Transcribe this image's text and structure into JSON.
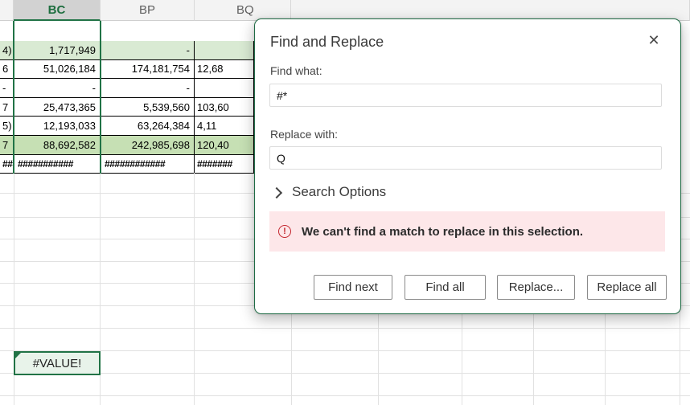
{
  "columns": [
    {
      "label": "BC",
      "selected": true
    },
    {
      "label": "BP",
      "selected": false
    },
    {
      "label": "BQ",
      "selected": false
    }
  ],
  "rows": [
    {
      "a": "4)",
      "bc": "1,717,949",
      "bp": "-",
      "bq": "",
      "style": "green"
    },
    {
      "a": "6",
      "bc": "51,026,184",
      "bp": "174,181,754",
      "bq": "12,68",
      "style": ""
    },
    {
      "a": "-",
      "bc": "-",
      "bp": "-",
      "bq": "",
      "style": ""
    },
    {
      "a": "7",
      "bc": "25,473,365",
      "bp": "5,539,560",
      "bq": "103,60",
      "style": ""
    },
    {
      "a": "5)",
      "bc": "12,193,033",
      "bp": "63,264,384",
      "bq": "4,11",
      "style": ""
    },
    {
      "a": "7",
      "bc": "88,692,582",
      "bp": "242,985,698",
      "bq": "120,40",
      "style": "green2"
    },
    {
      "a": "##",
      "bc": "###########",
      "bp": "############",
      "bq": "#######",
      "style": "hash"
    }
  ],
  "value_cell": "#VALUE!",
  "dialog": {
    "title": "Find and Replace",
    "close_symbol": "✕",
    "find_label": "Find what:",
    "find_value": "#*",
    "replace_label": "Replace with:",
    "replace_value": "Q",
    "search_options_label": "Search Options",
    "error_icon": "!",
    "error_message": "We can't find a match to replace in this selection.",
    "buttons": {
      "find_next": "Find next",
      "find_all": "Find all",
      "replace": "Replace...",
      "replace_all": "Replace all"
    }
  },
  "colors": {
    "accent": "#217346",
    "row_highlight": "#d9ead3",
    "total_highlight": "#c6e0b4",
    "error_bg": "#fde7e9",
    "error_icon": "#c4262e"
  }
}
